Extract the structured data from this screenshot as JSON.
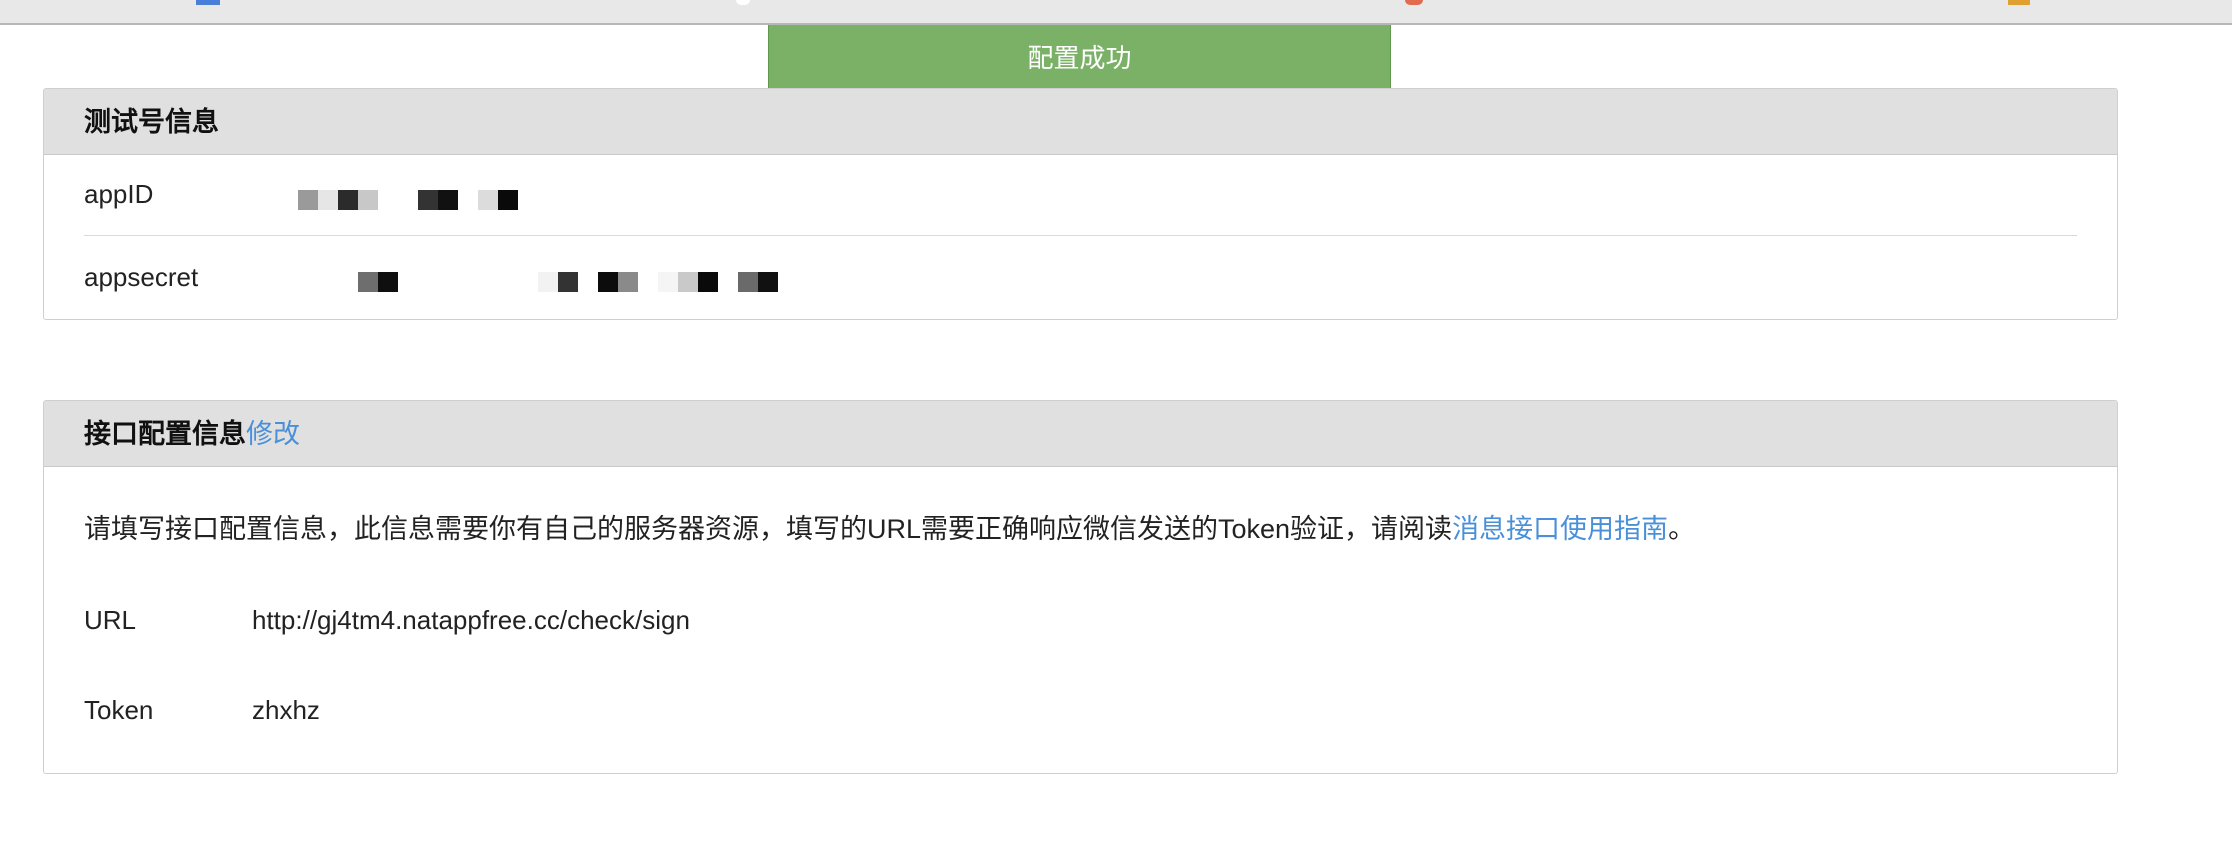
{
  "toast": {
    "text": "配置成功"
  },
  "test_account": {
    "header": "测试号信息",
    "appid_label": "appID",
    "appsecret_label": "appsecret"
  },
  "interface_config": {
    "header": "接口配置信息",
    "edit_link": "修改",
    "description_before": "请填写接口配置信息，此信息需要你有自己的服务器资源，填写的URL需要正确响应微信发送的Token验证，请阅读",
    "description_link": "消息接口使用指南",
    "description_after": "。",
    "url_label": "URL",
    "url_value": "http://gj4tm4.natappfree.cc/check/sign",
    "token_label": "Token",
    "token_value": "zhxhz"
  },
  "colors": {
    "toast_bg": "#7ab166",
    "header_bg": "#e0e0e0",
    "link": "#4a90d9"
  }
}
